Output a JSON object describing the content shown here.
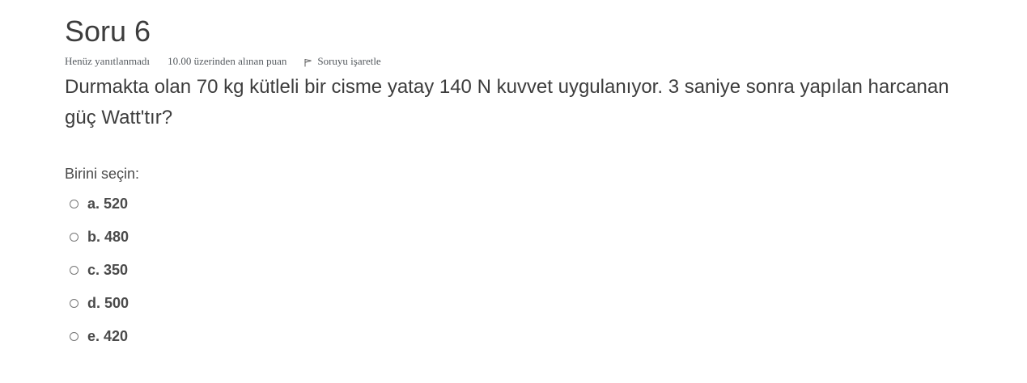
{
  "question": {
    "title": "Soru 6",
    "meta": {
      "status": "Henüz yanıtlanmadı",
      "points": "10.00 üzerinden alınan puan",
      "flag_label": "Soruyu işaretle",
      "flag_icon": "flag-icon"
    },
    "text": "Durmakta olan 70 kg kütleli bir cisme yatay 140 N kuvvet uygulanıyor. 3 saniye sonra yapılan harcanan güç Watt'tır?",
    "prompt": "Birini seçin:",
    "options": [
      {
        "label": "a. 520",
        "selected": false
      },
      {
        "label": "b. 480",
        "selected": false
      },
      {
        "label": "c. 350",
        "selected": false
      },
      {
        "label": "d. 500",
        "selected": false
      },
      {
        "label": "e. 420",
        "selected": false
      }
    ]
  }
}
